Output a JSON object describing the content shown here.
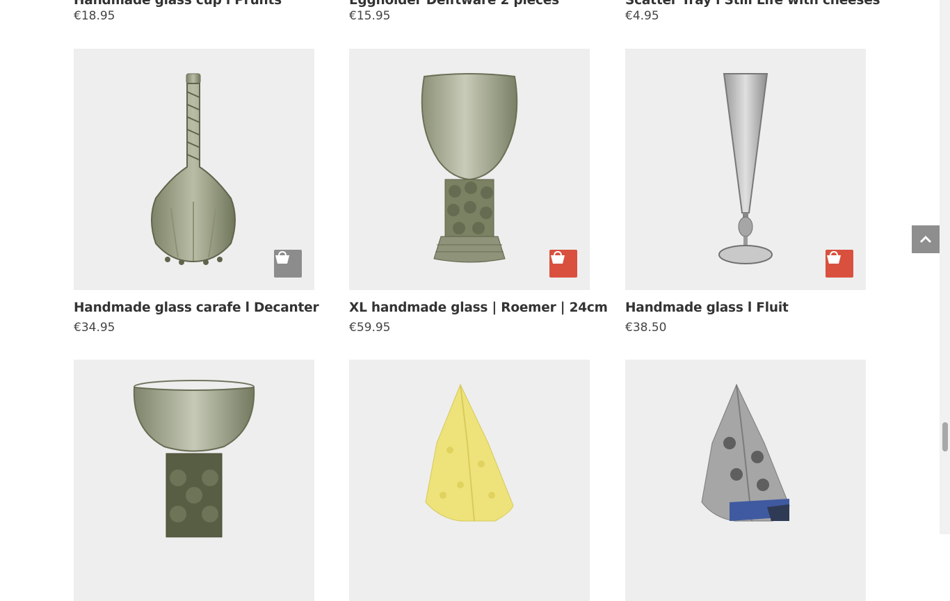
{
  "top_row": [
    {
      "title": "Handmade glass cup l Prunts",
      "price": "€18.95"
    },
    {
      "title": "Eggholder Delftware 2 pieces",
      "price": "€15.95"
    },
    {
      "title": "Scatter Tray l Still Life with cheeses",
      "price": "€4.95"
    }
  ],
  "products": [
    {
      "title": "Handmade glass carafe l Decanter",
      "price": "€34.95",
      "image_icon": "carafe-icon",
      "cart_color": "#8c8c8c"
    },
    {
      "title": "XL handmade glass | Roemer | 24cm",
      "price": "€59.95",
      "image_icon": "roemer-glass-icon",
      "cart_color": "#d9503f"
    },
    {
      "title": "Handmade glass l Fluit",
      "price": "€38.50",
      "image_icon": "flute-glass-icon",
      "cart_color": "#d9503f"
    },
    {
      "title": "",
      "price": "",
      "image_icon": "roemer-bowl-icon"
    },
    {
      "title": "",
      "price": "",
      "image_icon": "yellow-tea-towel-icon"
    },
    {
      "title": "",
      "price": "",
      "image_icon": "grey-tea-towel-icon"
    }
  ],
  "colors": {
    "accent_red": "#d9503f",
    "cart_gray": "#8c8c8c",
    "tile_bg": "#eeeeee"
  },
  "icons": {
    "cart": "shopping-bag-icon",
    "scroll_top": "chevron-up-icon"
  }
}
